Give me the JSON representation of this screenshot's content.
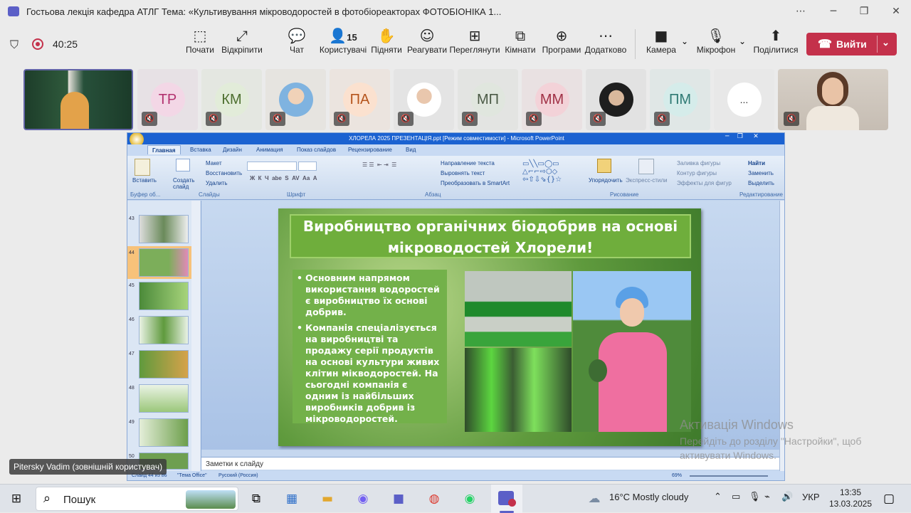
{
  "window": {
    "title": "Гостьова лекція кафедра АТЛГ Тема: «Культивування мікроводоростей в фотобіореакторах ФОТОБІОНІКА 1...",
    "controls": [
      "⋯",
      "─",
      "❐",
      "✕"
    ]
  },
  "meeting": {
    "timer": "40:25",
    "toolbar": [
      {
        "name": "start",
        "label": "Почати",
        "icon": "⬚"
      },
      {
        "name": "unpin",
        "label": "Відкріпити",
        "icon": "⤢"
      },
      {
        "name": "chat",
        "label": "Чат",
        "icon": "💬"
      },
      {
        "name": "people",
        "label": "Користувачі",
        "icon": "👤",
        "count": "15"
      },
      {
        "name": "raise",
        "label": "Підняти",
        "icon": "✋"
      },
      {
        "name": "react",
        "label": "Реагувати",
        "icon": "☺"
      },
      {
        "name": "view",
        "label": "Переглянути",
        "icon": "⊞"
      },
      {
        "name": "rooms",
        "label": "Кімнати",
        "icon": "⧉"
      },
      {
        "name": "apps",
        "label": "Програми",
        "icon": "⊕"
      },
      {
        "name": "more",
        "label": "Додатково",
        "icon": "⋯"
      }
    ],
    "devices": [
      {
        "name": "camera",
        "label": "Камера",
        "icon": "■"
      },
      {
        "name": "mic",
        "label": "Мікрофон",
        "icon": "🎙"
      },
      {
        "name": "share",
        "label": "Поділитися",
        "icon": "⬆"
      }
    ],
    "leave_label": "Вийти"
  },
  "participants": [
    {
      "initials": "",
      "type": "video"
    },
    {
      "initials": "ТР",
      "bg": "#f3d7e6",
      "fg": "#b33270"
    },
    {
      "initials": "КМ",
      "bg": "#e2ecd9",
      "fg": "#4d6f2f"
    },
    {
      "initials": "",
      "type": "photo"
    },
    {
      "initials": "ПА",
      "bg": "#fbe1cf",
      "fg": "#b5551d"
    },
    {
      "initials": "",
      "type": "photo"
    },
    {
      "initials": "МП",
      "bg": "#e0e6de",
      "fg": "#4b5a46"
    },
    {
      "initials": "ММ",
      "bg": "#f3d2d8",
      "fg": "#a03045"
    },
    {
      "initials": "",
      "type": "photo"
    },
    {
      "initials": "ПМ",
      "bg": "#d5ecea",
      "fg": "#2f7a74"
    },
    {
      "initials": "...",
      "bg": "#ffffff",
      "fg": "#333333"
    },
    {
      "initials": "",
      "type": "video"
    }
  ],
  "ppt": {
    "title": "ХЛОРЕЛА 2025 ПРЕЗЕНТАЦІЯ.ppt [Режим совместимости] - Microsoft PowerPoint",
    "tabs": [
      "Главная",
      "Вставка",
      "Дизайн",
      "Анимация",
      "Показ слайдов",
      "Рецензирование",
      "Вид"
    ],
    "groups": [
      "Буфер об...",
      "Слайды",
      "Шрифт",
      "Абзац",
      "Рисование",
      "Редактирование"
    ],
    "ribbon": {
      "paste": "Вставить",
      "create": "Создать слайд",
      "layout": "Макет",
      "reset": "Восстановить",
      "delete": "Удалить",
      "text_dir": "Направление текста",
      "align_text": "Выровнять текст",
      "smartart": "Преобразовать в SmartArt",
      "arrange": "Упорядочить",
      "quick_styles": "Экспресс-стили",
      "fill": "Заливка фигуры",
      "outline": "Контур фигуры",
      "effects": "Эффекты для фигур",
      "find": "Найти",
      "replace": "Заменить",
      "select": "Выделить"
    },
    "thumb_numbers": [
      "43",
      "44",
      "45",
      "46",
      "47",
      "48",
      "49",
      "50"
    ],
    "notes": "Заметки к слайду",
    "status": [
      "Слайд 44 из 86",
      "\"Тема Office\"",
      "Русский (Россия)",
      "69%"
    ],
    "slide": {
      "title": "Виробництво органічних біодобрив на основі мікроводостей Хлорели!",
      "bullets": [
        "Основним напрямом використання водоростей є виробництво їх основі добрив.",
        "Компанія спеціалізується на виробництві та продажу серії продуктів на основі культури живих клітин мікводоростей. На сьогодні компанія є одним із найбільших виробників добрив із мікроводоростей."
      ]
    }
  },
  "watermark": {
    "line1": "Активація Windows",
    "line2": "Перейдіть до розділу \"Настройки\", щоб",
    "line3": "активувати Windows."
  },
  "presenter_name": "Pitersky Vadim (зовнішній користувач)",
  "taskbar": {
    "search": "Пошук",
    "weather": "16°C  Mostly cloudy",
    "language": "УКР",
    "time": "13:35",
    "date": "13.03.2025"
  }
}
